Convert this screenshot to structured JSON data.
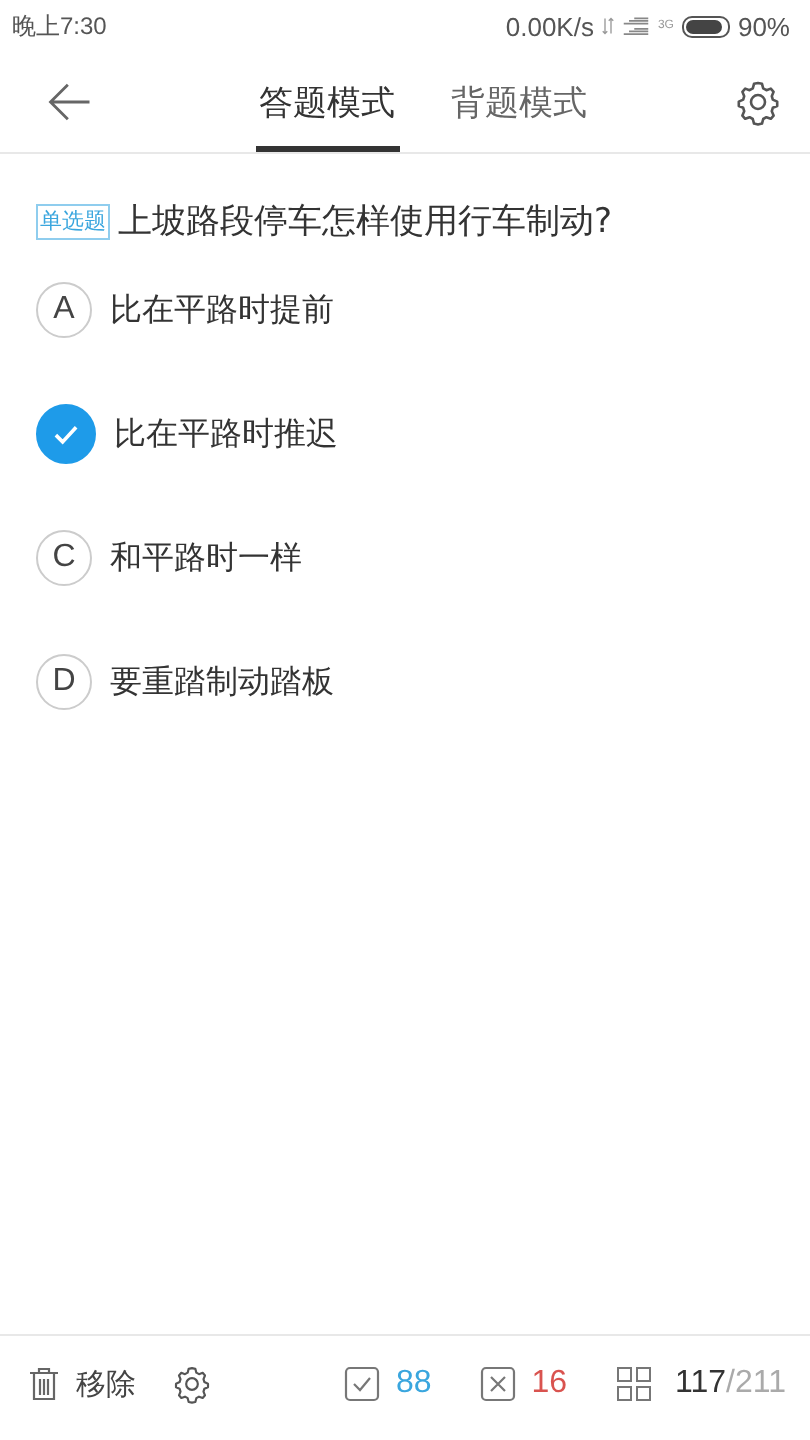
{
  "status_bar": {
    "time": "晚上7:30",
    "speed": "0.00K/s",
    "network": "3G",
    "battery_text": "90%"
  },
  "header": {
    "tabs": [
      {
        "label": "答题模式",
        "selected": true
      },
      {
        "label": "背题模式",
        "selected": false
      }
    ]
  },
  "question": {
    "tag": "单选题",
    "text": "上坡路段停车怎样使用行车制动?"
  },
  "options": [
    {
      "letter": "A",
      "text": "比在平路时提前",
      "selected": false
    },
    {
      "text": "比在平路时推迟",
      "selected": true
    },
    {
      "letter": "C",
      "text": "和平路时一样",
      "selected": false
    },
    {
      "letter": "D",
      "text": "要重踏制动踏板",
      "selected": false
    }
  ],
  "footer": {
    "remove": "移除",
    "correct": "88",
    "wrong": "16",
    "current": "117",
    "total": "/211"
  }
}
